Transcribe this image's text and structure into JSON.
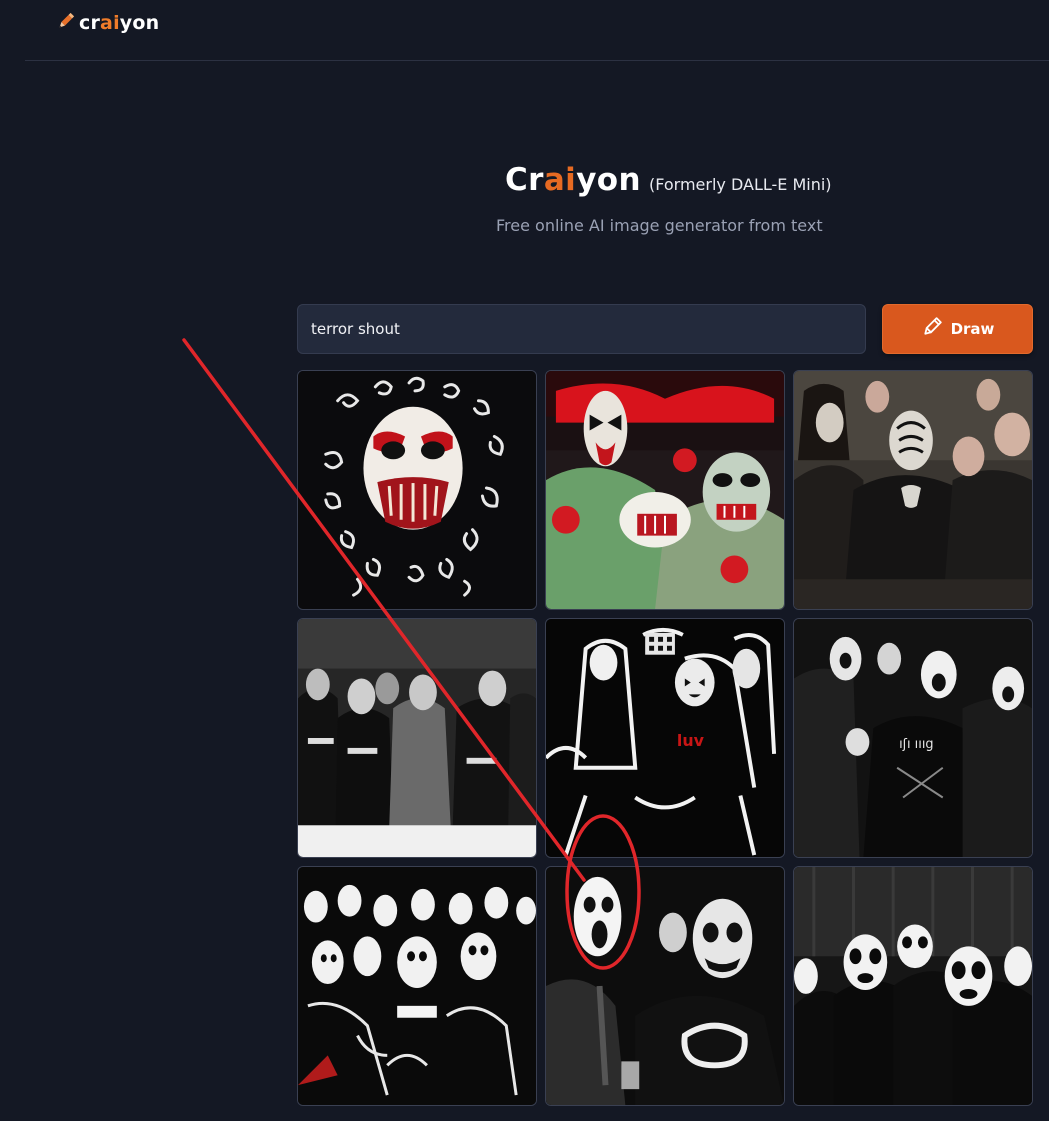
{
  "header": {
    "logo_prefix": "cr",
    "logo_ai": "ai",
    "logo_suffix": "yon",
    "logo_icon": "pencil-icon"
  },
  "hero": {
    "brand_prefix": "Cr",
    "brand_ai": "ai",
    "brand_suffix": "yon",
    "formerly": "(Formerly DALL-E Mini)",
    "subtitle": "Free online AI image generator from text"
  },
  "search": {
    "value": "terror shout"
  },
  "draw_button": {
    "label": "Draw",
    "icon": "pencil-icon"
  },
  "images": {
    "count": 9,
    "t3_shirt_text": "",
    "t6_shirt_text": "ıʃı ıııց"
  },
  "annotation": {
    "color": "#e0262a",
    "shapes": [
      "diagonal-line",
      "ellipse-highlight"
    ]
  },
  "colors": {
    "background": "#141824",
    "accent": "#e76a22",
    "button": "#d9581e",
    "input_bg": "#232a3c"
  }
}
